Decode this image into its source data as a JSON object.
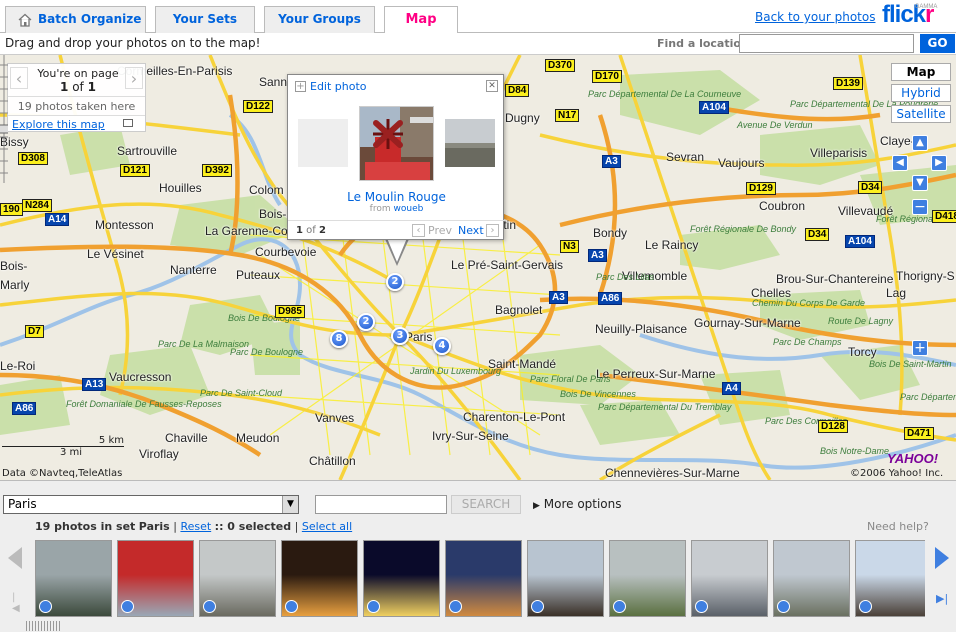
{
  "tabs": {
    "batch": "Batch Organize",
    "sets": "Your Sets",
    "groups": "Your Groups",
    "map": "Map"
  },
  "back_link": "Back to your photos",
  "logo": {
    "part1": "flick",
    "part2": "r",
    "badge": "GAMMA"
  },
  "toolbar": {
    "instruction": "Drag and drop your photos on to the map!",
    "find_label": "Find a location",
    "find_value": "",
    "go_label": "GO"
  },
  "page_panel": {
    "title": "You're on page",
    "current": "1",
    "of": "of",
    "total": "1",
    "taken": "19 photos taken here",
    "explore": "Explore this map"
  },
  "map_types": {
    "map": "Map",
    "hybrid": "Hybrid",
    "satellite": "Satellite"
  },
  "popup": {
    "edit": "Edit photo",
    "title": "Le Moulin Rouge",
    "from_prefix": "from",
    "from_user": "woueb",
    "index": "1",
    "of_text": "of",
    "total": "2",
    "prev": "Prev",
    "next": "Next"
  },
  "markers": [
    "2",
    "2",
    "3",
    "8",
    "4"
  ],
  "map_labels": {
    "towns": [
      "Cormeilles-En-Parisis",
      "Sann",
      "Dugny",
      "Bissy",
      "Sartrouville",
      "Houilles",
      "Colom",
      "Bois-",
      "Montesson",
      "La Garenne-Col",
      "Le Vésinet",
      "Courbevoie",
      "Nanterre",
      "Puteaux",
      "Sevran",
      "Vaujours",
      "Villeparisis",
      "Claye-",
      "Coubron",
      "Villevaudé",
      "Bondy",
      "Le Raincy",
      "Pantin",
      "Le Pré-Saint-Gervais",
      "Villemomble",
      "Chelles",
      "Brou-Sur-Chantereine",
      "Bagnolet",
      "Neuilly-Plaisance",
      "Gournay-Sur-Marne",
      "Paris",
      "Saint-Mandé",
      "Le Perreux-Sur-Marne",
      "Torcy",
      "Le-Roi",
      "Vaucresson",
      "Chaville",
      "Meudon",
      "Vanves",
      "Charenton-Le-Pont",
      "Ivry-Sur-Seine",
      "Châtillon",
      "Chennevières-Sur-Marne",
      "Viroflay",
      "Thorigny-S",
      "Lag",
      "Bois-",
      "Saint-Maur",
      "Marly",
      "Sunio"
    ],
    "parks": [
      "Parc Départemental De La Courneuve",
      "Parc Départemental De La Poudrerie",
      "Forêt Régionale De Bondy",
      "Parc De La Malmaison",
      "Parc De Boulogne",
      "Bois De Boulogne",
      "Forêt Domaniale De Fausses-Reposes",
      "Parc De Saint-Cloud",
      "Parc Floral De Paris",
      "Bois De Vincennes",
      "Forêt Régionale De Brou",
      "Parc Des Cormailles",
      "Parc Des Lilas",
      "Parc Départemental Du Tremblay",
      "Bois De Saint-Martin",
      "Parc De Champs",
      "Parc Départemental Des Glaises",
      "Bois Notre-Dame",
      "Jardin Du Luxembourg",
      "Chemin Du Corps De Garde",
      "Avenue De Verdun",
      "Route De Lagny"
    ],
    "roads": [
      "D370",
      "D170",
      "D139",
      "D122",
      "N17",
      "A104",
      "D84",
      "D308",
      "D121",
      "D392",
      "A3",
      "D129",
      "D34",
      "D418",
      "N284",
      "A14",
      "N3",
      "A104",
      "D34",
      "A86",
      "A3",
      "A3",
      "D985",
      "D7",
      "A13",
      "A4",
      "A86",
      "D128",
      "D471",
      "190"
    ]
  },
  "scale": {
    "km": "5 km",
    "mi": "3 mi"
  },
  "attribution": "Data ©Navteq,TeleAtlas",
  "copyright": "©2006 Yahoo! Inc.",
  "yahoo": "YAHOO!",
  "bottom": {
    "set_value": "Paris",
    "search_value": "",
    "search_label": "SEARCH",
    "more_options": "More options",
    "summary_count": "19 photos in set",
    "summary_set": "Paris",
    "reset": "Reset",
    "selected": ":: 0 selected",
    "select_all": "Select all",
    "help": "Need help?"
  },
  "thumbnails": [
    {
      "name": "greenhouse",
      "colors": [
        "#9aa5a8",
        "#3c4a3c"
      ]
    },
    {
      "name": "moulin-rouge",
      "colors": [
        "#c42a2a",
        "#9aa8b6"
      ]
    },
    {
      "name": "skyline-haze",
      "colors": [
        "#c4c8c8",
        "#6a6a60"
      ]
    },
    {
      "name": "eiffel-night-gold",
      "colors": [
        "#2a1a10",
        "#e8a040"
      ]
    },
    {
      "name": "eiffel-night-blue",
      "colors": [
        "#0a0a2a",
        "#f0d060"
      ]
    },
    {
      "name": "eiffel-dusk",
      "colors": [
        "#2a3a6a",
        "#d08a40"
      ]
    },
    {
      "name": "eiffel-underside",
      "colors": [
        "#b8c4d0",
        "#3a3028"
      ]
    },
    {
      "name": "champ-de-mars",
      "colors": [
        "#b8c0c0",
        "#5a7040"
      ]
    },
    {
      "name": "la-defense",
      "colors": [
        "#c8ccd0",
        "#5a6068"
      ]
    },
    {
      "name": "trocadero",
      "colors": [
        "#c0c8d0",
        "#6a7060"
      ]
    },
    {
      "name": "eiffel-day",
      "colors": [
        "#cad8e8",
        "#4a4038"
      ]
    }
  ]
}
